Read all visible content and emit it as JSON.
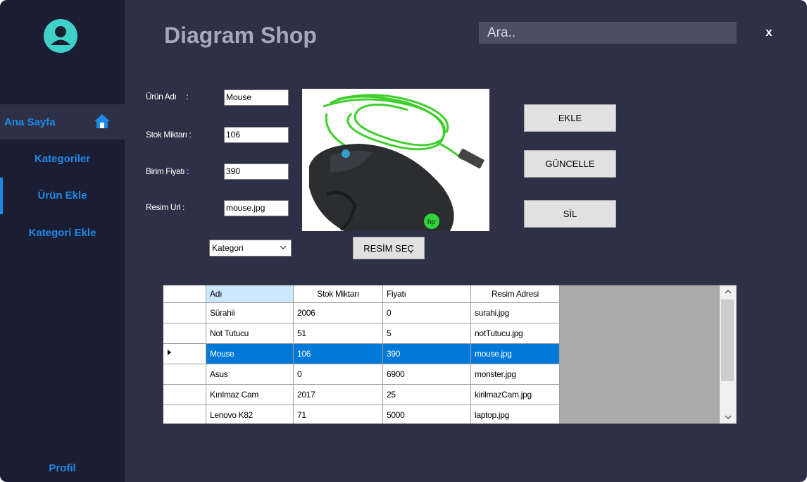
{
  "app": {
    "title": "Diagram Shop",
    "close_label": "x"
  },
  "search": {
    "placeholder": "Ara.."
  },
  "sidebar": {
    "items": [
      {
        "label": "Ana Sayfa"
      },
      {
        "label": "Kategoriler"
      },
      {
        "label": "Ürün Ekle"
      },
      {
        "label": "Kategori Ekle"
      }
    ],
    "profile_label": "Profil"
  },
  "form": {
    "name_label": "Ürün Adı",
    "name_colon": ":",
    "name_value": "Mouse",
    "stock_label": "Stok Miktarı :",
    "stock_value": "106",
    "price_label": "Birim Fiyatı :",
    "price_value": "390",
    "url_label": "Resim Url :",
    "url_value": "mouse.jpg",
    "category_selected": "Kategori"
  },
  "buttons": {
    "add": "EKLE",
    "update": "GÜNCELLE",
    "delete": "SİL",
    "choose_image": "RESİM SEÇ"
  },
  "table": {
    "columns": [
      "Adı",
      "Stok Miktarı",
      "Fiyatı",
      "Resim Adresi"
    ],
    "rows": [
      [
        "Sürahii",
        "2006",
        "0",
        "surahi.jpg"
      ],
      [
        "Not Tutucu",
        "51",
        "5",
        "notTutucu.jpg"
      ],
      [
        "Mouse",
        "106",
        "390",
        "mouse.jpg"
      ],
      [
        "Asus",
        "0",
        "6900",
        "monster.jpg"
      ],
      [
        "Kırılmaz Cam",
        "2017",
        "25",
        "kirilmazCam.jpg"
      ],
      [
        "Lenovo K82",
        "71",
        "5000",
        "laptop.jpg"
      ]
    ],
    "selected_row": 2
  },
  "colors": {
    "accent": "#1e88e5",
    "sidebar_bg": "#1b1e33",
    "main_bg": "#2e3047",
    "avatar": "#3fd1c8",
    "selection": "#0078d7"
  }
}
